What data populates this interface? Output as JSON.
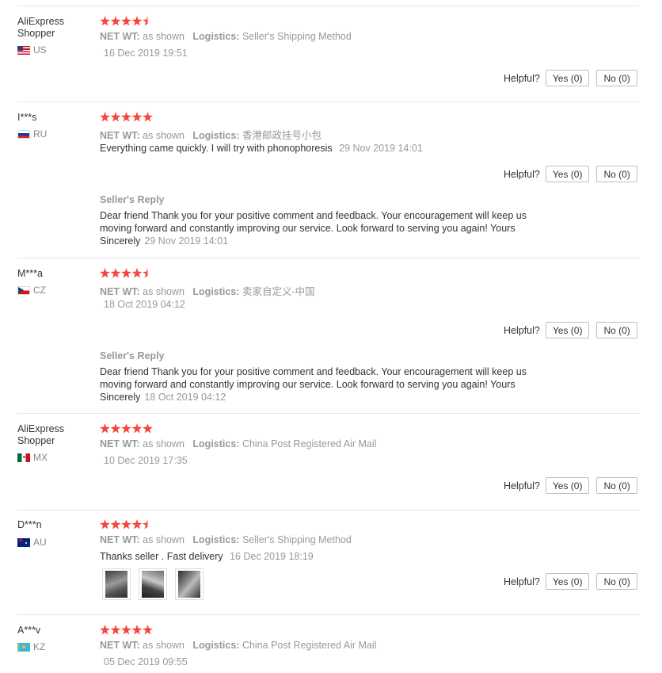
{
  "labels": {
    "net_wt": "NET WT:",
    "logistics": "Logistics:",
    "helpful": "Helpful?",
    "seller_reply": "Seller's Reply"
  },
  "reviews": [
    {
      "user": "AliExpress Shopper",
      "country": "US",
      "rating": 4.5,
      "net_wt": "as shown",
      "logistics": "Seller's Shipping Method",
      "comment": "",
      "date": "16 Dec 2019 19:51",
      "yes": "Yes (0)",
      "no": "No (0)"
    },
    {
      "user": "I***s",
      "country": "RU",
      "rating": 5,
      "net_wt": "as shown",
      "logistics": "香港邮政挂号小包",
      "comment": "Everything came quickly. I will try with phonophoresis",
      "date": "29 Nov 2019 14:01",
      "yes": "Yes (0)",
      "no": "No (0)",
      "reply": {
        "line1": "Dear friend Thank you for your positive comment and feedback. Your encouragement will keep us",
        "line2": "moving forward and constantly improving our service. Look forward to serving you again! Yours",
        "line3": "Sincerely",
        "date": "29 Nov 2019 14:01"
      }
    },
    {
      "user": "M***a",
      "country": "CZ",
      "rating": 4.5,
      "net_wt": "as shown",
      "logistics": "卖家自定义-中国",
      "comment": "",
      "date": "18 Oct 2019 04:12",
      "yes": "Yes (0)",
      "no": "No (0)",
      "reply": {
        "line1": "Dear friend Thank you for your positive comment and feedback. Your encouragement will keep us",
        "line2": "moving forward and constantly improving our service. Look forward to serving you again! Yours",
        "line3": "Sincerely",
        "date": "18 Oct 2019 04:12"
      }
    },
    {
      "user": "AliExpress Shopper",
      "country": "MX",
      "rating": 5,
      "net_wt": "as shown",
      "logistics": "China Post Registered Air Mail",
      "comment": "",
      "date": "10 Dec 2019 17:35",
      "yes": "Yes (0)",
      "no": "No (0)"
    },
    {
      "user": "D***n",
      "country": "AU",
      "rating": 4.5,
      "net_wt": "as shown",
      "logistics": "Seller's Shipping Method",
      "comment": "Thanks seller . Fast delivery",
      "date": "16 Dec 2019 18:19",
      "yes": "Yes (0)",
      "no": "No (0)"
    },
    {
      "user": "A***v",
      "country": "KZ",
      "rating": 5,
      "net_wt": "as shown",
      "logistics": "China Post Registered Air Mail",
      "comment": "",
      "date": "05 Dec 2019 09:55"
    }
  ]
}
